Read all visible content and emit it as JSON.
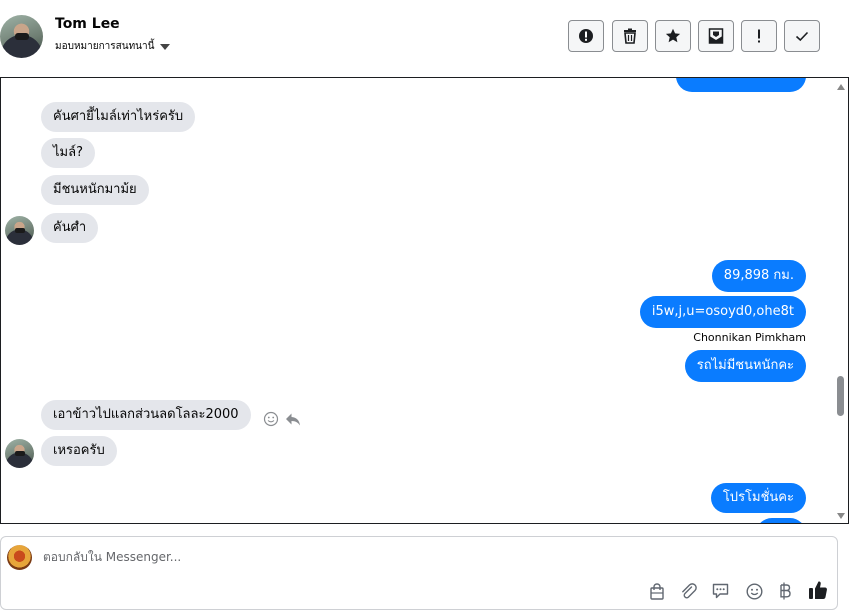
{
  "header": {
    "contact_name": "Tom Lee",
    "assign_label": "มอบหมายการสนทนานี้",
    "tools": [
      "exclamation-circle-icon",
      "trash-icon",
      "star-icon",
      "archive-envelope-icon",
      "exclamation-icon",
      "check-icon"
    ]
  },
  "conversation": {
    "incoming_1": "คันศายี้ไมล์เท่าไหร่ครับ",
    "incoming_2": "ไมล์?",
    "incoming_3": "มีชนหนักมาม้ย",
    "incoming_4": "คันศำ",
    "outgoing_1": "89,898 กม.",
    "outgoing_2": "i5w,j,u=osoyd0,ohe8t",
    "sender_name": "Chonnikan Pimkham",
    "outgoing_3": "รถไม่มีชนหนักคะ",
    "incoming_5": "เอาข้าวไปแลกส่วนลดโลละ2000",
    "incoming_6": "เหรอครับ",
    "outgoing_4": "โปรโมชั่นคะ"
  },
  "composer": {
    "placeholder": "ตอบกลับใน Messenger...",
    "tools": [
      "shopping-bag-icon",
      "paperclip-icon",
      "saved-reply-icon",
      "emoji-icon",
      "baht-icon",
      "like-icon"
    ]
  },
  "colors": {
    "outgoing_bubble": "#0a7cff",
    "incoming_bubble": "#e4e6eb",
    "like_icon": "#1c1e21"
  }
}
